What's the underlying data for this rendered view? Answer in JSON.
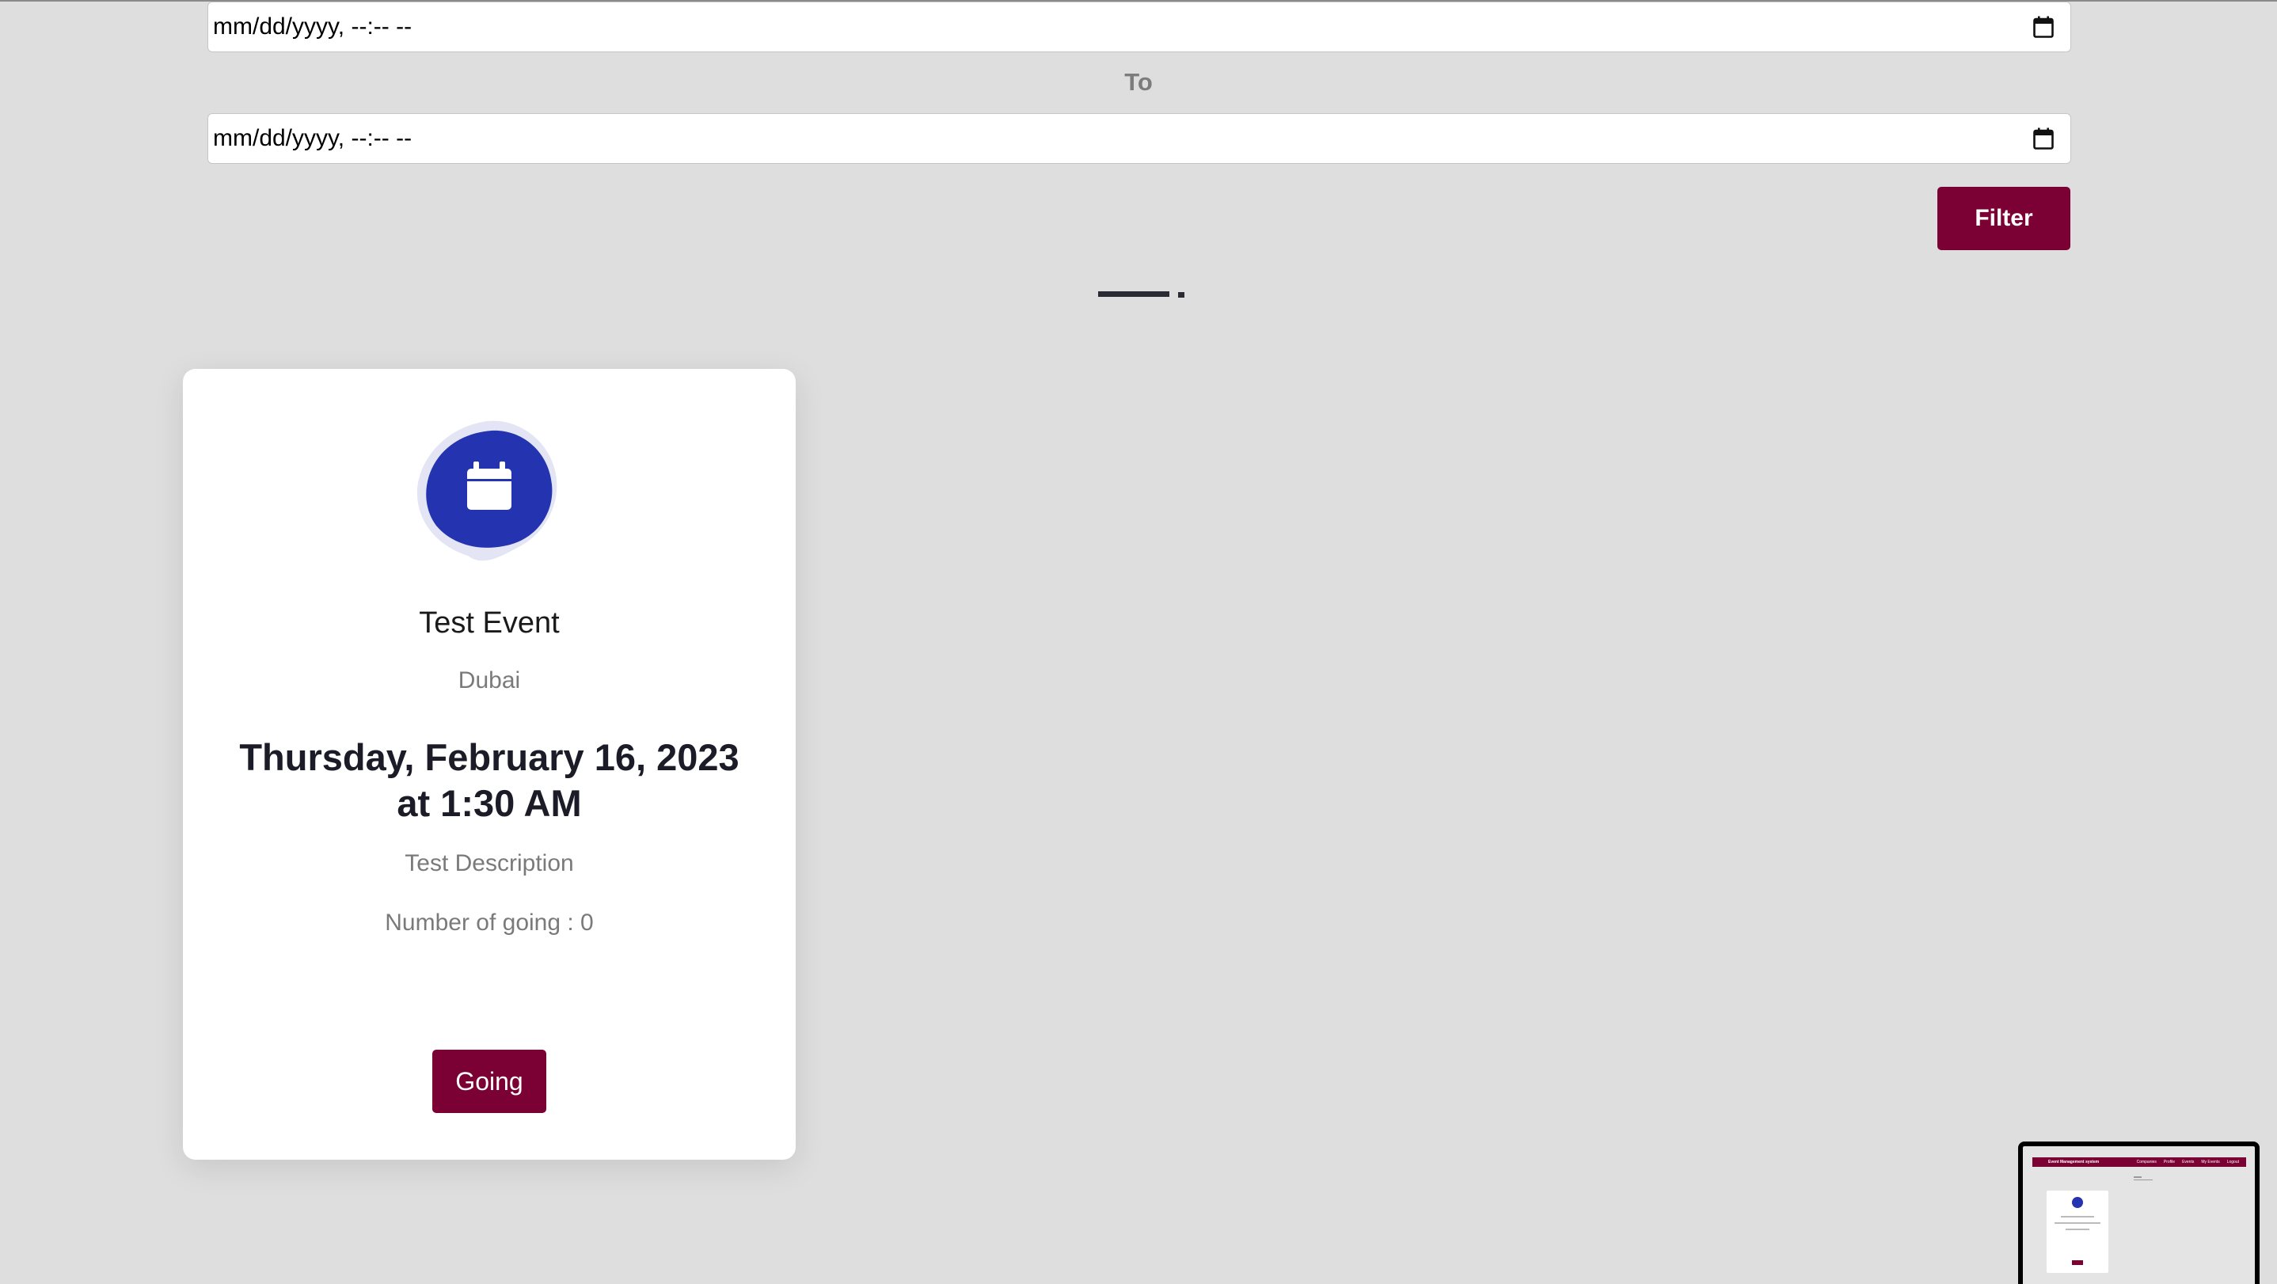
{
  "filters": {
    "from_value": "mm/dd/yyyy, --:-- --",
    "to_label": "To",
    "to_value": "mm/dd/yyyy, --:-- --",
    "filter_button": "Filter"
  },
  "event": {
    "icon": "calendar-icon",
    "title": "Test Event",
    "location": "Dubai",
    "date_line1": "Thursday, February 16, 2023",
    "date_line2": "at 1:30 AM",
    "description": "Test Description",
    "going_count": "Number of going : 0",
    "going_button": "Going"
  },
  "preview": {
    "app_title": "Event Management system",
    "nav": [
      "Companies",
      "Profile",
      "Events",
      "My Events",
      "Logout"
    ]
  },
  "colors": {
    "page_background": "#dedede",
    "accent": "#7b0033",
    "icon_blob": "#2433b0"
  }
}
